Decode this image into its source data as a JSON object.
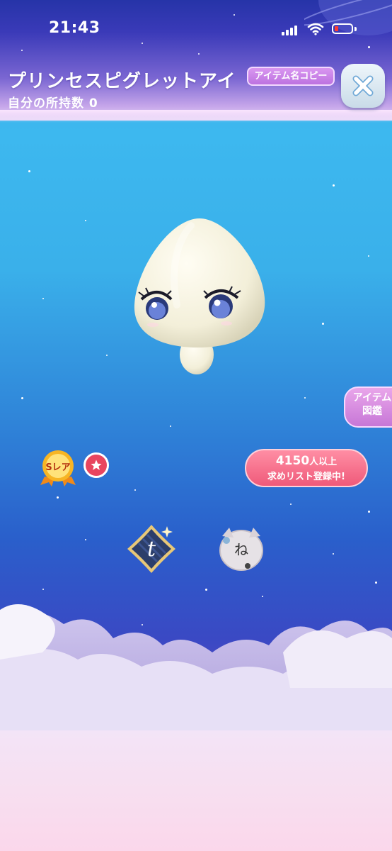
{
  "status_bar": {
    "time": "21:43"
  },
  "header": {
    "title": "プリンセスピグレットアイ",
    "owned_count": "自分の所持数 0",
    "copy_button_label": "アイテム名コピー"
  },
  "side_tab": {
    "line1": "アイテム",
    "line2": "図鑑"
  },
  "rarity": {
    "label": "Sレア"
  },
  "wishlist": {
    "count": "4150",
    "count_suffix": "人以上",
    "status": "求めリスト登録中!"
  },
  "tag_icons": {
    "t_icon_letter": "t",
    "cat_icon_letter": "ね"
  },
  "colors": {
    "accent_pink": "#ef5a7a",
    "accent_purple": "#bd72e0",
    "sky_blue": "#3db8ef"
  }
}
